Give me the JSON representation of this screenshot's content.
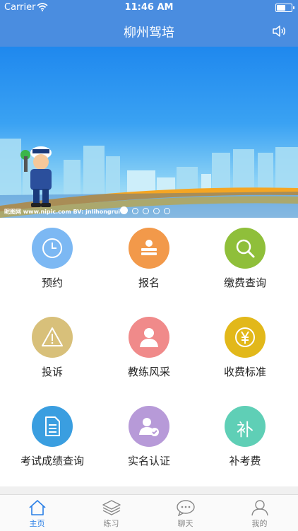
{
  "status": {
    "carrier": "Carrier",
    "time": "11:46 AM"
  },
  "nav": {
    "title": "柳州驾培",
    "speaker_icon": "speaker-icon"
  },
  "banner": {
    "caption": "昵图网 www.nipic.com   BV: jnlihongrui",
    "slides": 5,
    "active_slide": 1
  },
  "grid": [
    {
      "label": "预约",
      "icon": "clock-icon",
      "color": "#7cb8f3"
    },
    {
      "label": "报名",
      "icon": "register-icon",
      "color": "#f2994a"
    },
    {
      "label": "缴费查询",
      "icon": "search-icon",
      "color": "#8fbf3a"
    },
    {
      "label": "投诉",
      "icon": "warning-icon",
      "color": "#d8c07a"
    },
    {
      "label": "教练风采",
      "icon": "person-icon",
      "color": "#f08a8a"
    },
    {
      "label": "收费标准",
      "icon": "yen-icon",
      "color": "#e2b81a"
    },
    {
      "label": "考试成绩查询",
      "icon": "document-icon",
      "color": "#3a9ee0"
    },
    {
      "label": "实名认证",
      "icon": "verify-user-icon",
      "color": "#b79ad8"
    },
    {
      "label": "补考费",
      "icon": "bu-char-icon",
      "color": "#5fcfb6",
      "glyph": "补"
    }
  ],
  "tabs": [
    {
      "label": "主页",
      "icon": "home-icon",
      "active": true
    },
    {
      "label": "练习",
      "icon": "layers-icon",
      "active": false
    },
    {
      "label": "聊天",
      "icon": "chat-icon",
      "active": false
    },
    {
      "label": "我的",
      "icon": "profile-icon",
      "active": false
    }
  ]
}
